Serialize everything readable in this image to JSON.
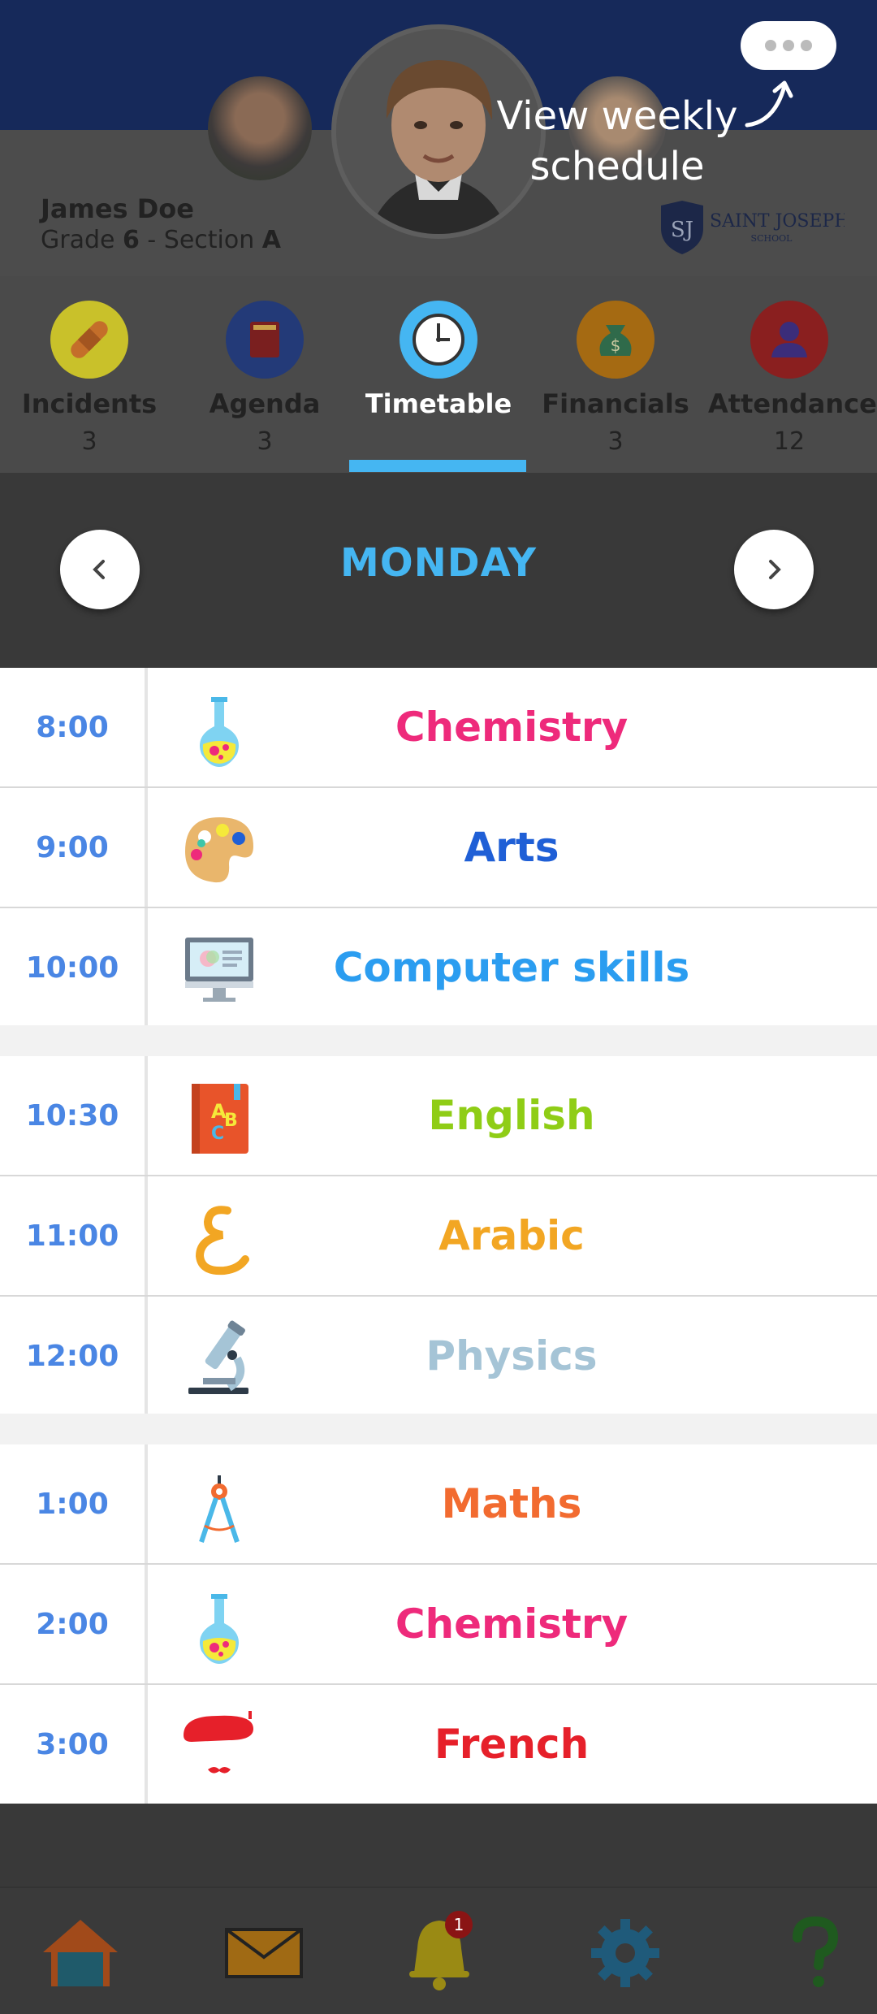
{
  "student": {
    "name": "James Doe",
    "grade_prefix": "Grade ",
    "grade": "6",
    "section_prefix": " - Section ",
    "section": "A"
  },
  "school": {
    "name": "SAINT JOSEPH",
    "subtitle": "SCHOOL",
    "initials": "SJ"
  },
  "overlay": {
    "hint": "View weekly schedule",
    "more_icon": "more-dots-icon"
  },
  "tabs": [
    {
      "label": "Incidents",
      "count": "3",
      "icon": "bandage-icon",
      "color": "#c9c12a",
      "active": false
    },
    {
      "label": "Agenda",
      "count": "3",
      "icon": "book-icon",
      "color": "#233a78",
      "active": false
    },
    {
      "label": "Timetable",
      "count": "",
      "icon": "clock-icon",
      "color": "#45b6f2",
      "active": true
    },
    {
      "label": "Financials",
      "count": "3",
      "icon": "money-bag-icon",
      "color": "#a56a12",
      "active": false
    },
    {
      "label": "Attendance",
      "count": "12",
      "icon": "person-icon",
      "color": "#8a1f1f",
      "active": false
    }
  ],
  "day": {
    "label": "MONDAY"
  },
  "schedule": [
    [
      {
        "time": "8:00",
        "subject": "Chemistry",
        "color": "#ee2a7b",
        "icon": "flask-icon"
      },
      {
        "time": "9:00",
        "subject": "Arts",
        "color": "#1f5fd6",
        "icon": "palette-icon"
      },
      {
        "time": "10:00",
        "subject": "Computer skills",
        "color": "#2b9df0",
        "icon": "computer-icon"
      }
    ],
    [
      {
        "time": "10:30",
        "subject": "English",
        "color": "#8fcd16",
        "icon": "abc-book-icon"
      },
      {
        "time": "11:00",
        "subject": "Arabic",
        "color": "#f2a623",
        "icon": "arabic-letter-icon"
      },
      {
        "time": "12:00",
        "subject": "Physics",
        "color": "#a5c4d6",
        "icon": "microscope-icon"
      }
    ],
    [
      {
        "time": "1:00",
        "subject": "Maths",
        "color": "#f26b30",
        "icon": "compass-icon"
      },
      {
        "time": "2:00",
        "subject": "Chemistry",
        "color": "#ee2a7b",
        "icon": "flask-icon"
      },
      {
        "time": "3:00",
        "subject": "French",
        "color": "#e6202a",
        "icon": "beret-icon"
      }
    ]
  ],
  "bottom_nav": {
    "notification_badge": "1",
    "items": [
      "home-icon",
      "mail-icon",
      "bell-icon",
      "gear-icon",
      "help-icon"
    ]
  }
}
